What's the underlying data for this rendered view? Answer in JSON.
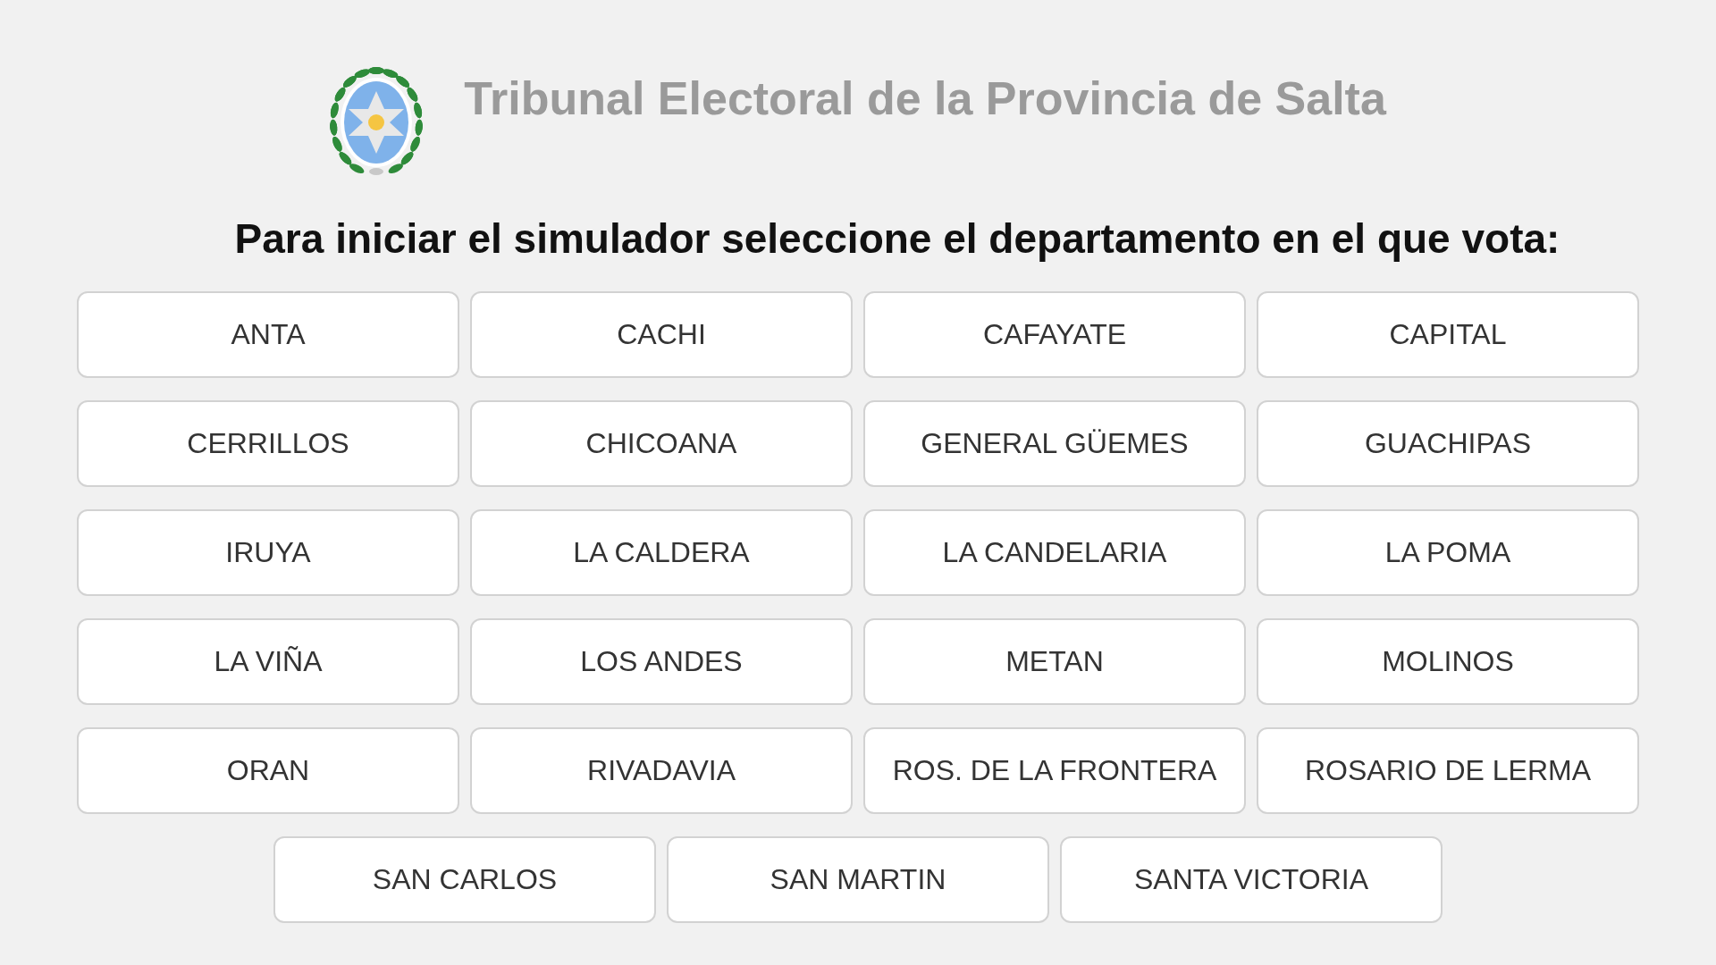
{
  "header": {
    "title": "Tribunal Electoral de la Provincia de Salta"
  },
  "prompt": "Para iniciar el simulador seleccione el departamento en el que vota:",
  "departments": [
    "ANTA",
    "CACHI",
    "CAFAYATE",
    "CAPITAL",
    "CERRILLOS",
    "CHICOANA",
    "GENERAL GÜEMES",
    "GUACHIPAS",
    "IRUYA",
    "LA CALDERA",
    "LA CANDELARIA",
    "LA POMA",
    "LA VIÑA",
    "LOS ANDES",
    "METAN",
    "MOLINOS",
    "ORAN",
    "RIVADAVIA",
    "ROS. DE LA FRONTERA",
    "ROSARIO DE LERMA",
    "SAN CARLOS",
    "SAN MARTIN",
    "SANTA VICTORIA"
  ]
}
